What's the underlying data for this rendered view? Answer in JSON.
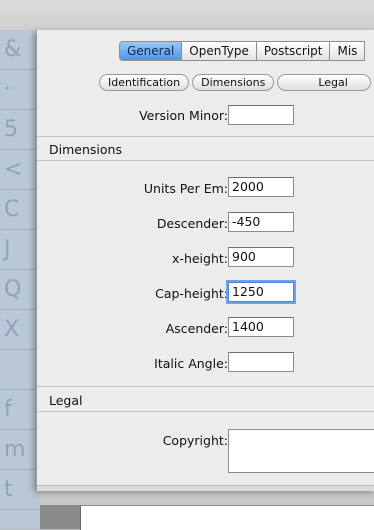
{
  "tabs": [
    {
      "label": "General",
      "active": true
    },
    {
      "label": "OpenType",
      "active": false
    },
    {
      "label": "Postscript",
      "active": false
    },
    {
      "label": "Mis",
      "active": false
    }
  ],
  "subtabs": [
    {
      "label": "Identification"
    },
    {
      "label": "Dimensions"
    },
    {
      "label": "Legal"
    }
  ],
  "identification": {
    "version_minor_label": "Version Minor:",
    "version_minor_value": ""
  },
  "dimensions": {
    "header": "Dimensions",
    "units_per_em_label": "Units Per Em:",
    "units_per_em_value": "2000",
    "descender_label": "Descender:",
    "descender_value": "-450",
    "x_height_label": "x-height:",
    "x_height_value": "900",
    "cap_height_label": "Cap-height:",
    "cap_height_value": "1250",
    "ascender_label": "Ascender:",
    "ascender_value": "1400",
    "italic_angle_label": "Italic Angle:",
    "italic_angle_value": ""
  },
  "legal": {
    "header": "Legal",
    "copyright_label": "Copyright:",
    "copyright_value": ""
  },
  "glyph_strip": [
    "&",
    "·",
    "5",
    "<",
    "C",
    "J",
    "Q",
    "X",
    "",
    "f",
    "m",
    "t"
  ],
  "colors": {
    "active_tab": "#4f96e6",
    "focus_ring": "#6aa5e8"
  }
}
